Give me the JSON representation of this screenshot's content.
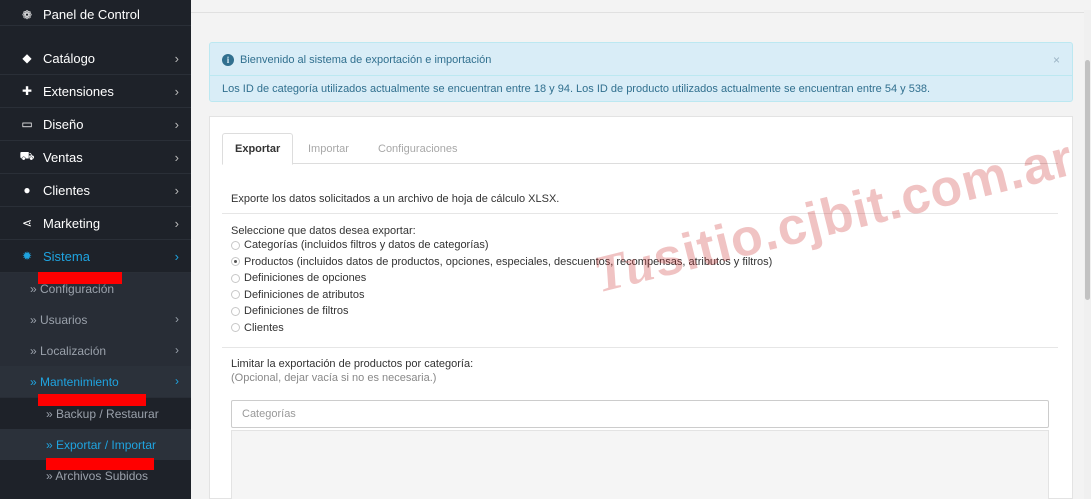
{
  "sidebar": {
    "items": [
      {
        "icon": "dashboard-icon",
        "glyph": "❁",
        "label": "Panel de Control",
        "chevron": false
      },
      {
        "icon": "tag-icon",
        "glyph": "◆",
        "label": "Catálogo",
        "chevron": true
      },
      {
        "icon": "puzzle-icon",
        "glyph": "✚",
        "label": "Extensiones",
        "chevron": true
      },
      {
        "icon": "monitor-icon",
        "glyph": "▭",
        "label": "Diseño",
        "chevron": true
      },
      {
        "icon": "cart-icon",
        "glyph": "⛟",
        "label": "Ventas",
        "chevron": true
      },
      {
        "icon": "user-icon",
        "glyph": "●",
        "label": "Clientes",
        "chevron": true
      },
      {
        "icon": "share-icon",
        "glyph": "⋖",
        "label": "Marketing",
        "chevron": true
      },
      {
        "icon": "cog-icon",
        "glyph": "✹",
        "label": "Sistema",
        "chevron": true
      }
    ],
    "system_sub": [
      {
        "label": "» Configuración",
        "chevron": false
      },
      {
        "label": "» Usuarios",
        "chevron": true
      },
      {
        "label": "» Localización",
        "chevron": true
      },
      {
        "label": "» Mantenimiento",
        "chevron": true
      }
    ],
    "maintenance_sub": [
      {
        "label": "» Backup / Restaurar"
      },
      {
        "label": "» Exportar / Importar"
      },
      {
        "label": "» Archivos Subidos"
      }
    ],
    "chevron_glyph": "›"
  },
  "alert": {
    "title": "Bienvenido al sistema de exportación e importación",
    "info_glyph": "i",
    "close_glyph": "×",
    "message": "Los ID de categoría utilizados actualmente se encuentran entre 18 y 94. Los ID de producto utilizados actualmente se encuentran entre 54 y 538."
  },
  "tabs": [
    "Exportar",
    "Importar",
    "Configuraciones"
  ],
  "export": {
    "description": "Exporte los datos solicitados a un archivo de hoja de cálculo XLSX.",
    "select_title": "Seleccione que datos desea exportar:",
    "options": [
      {
        "label": "Categorías (incluidos filtros y datos de categorías)",
        "checked": false
      },
      {
        "label": "Productos (incluidos datos de productos, opciones, especiales, descuentos, recompensas, atributos y filtros)",
        "checked": true
      },
      {
        "label": "Definiciones de opciones",
        "checked": false
      },
      {
        "label": "Definiciones de atributos",
        "checked": false
      },
      {
        "label": "Definiciones de filtros",
        "checked": false
      },
      {
        "label": "Clientes",
        "checked": false
      }
    ],
    "limit_title": "Limitar la exportación de productos por categoría:",
    "limit_help": "(Opcional, dejar vacía si no es necesaria.)",
    "categories_placeholder": "Categorías"
  },
  "watermark": {
    "prefix": "Tu",
    "text": "sitio.cjbit.com.ar"
  },
  "colors": {
    "sidebar_bg": "#1e2229",
    "accent": "#1fa4e0",
    "alert_bg": "#d9edf7",
    "redaction": "#ff0000"
  }
}
